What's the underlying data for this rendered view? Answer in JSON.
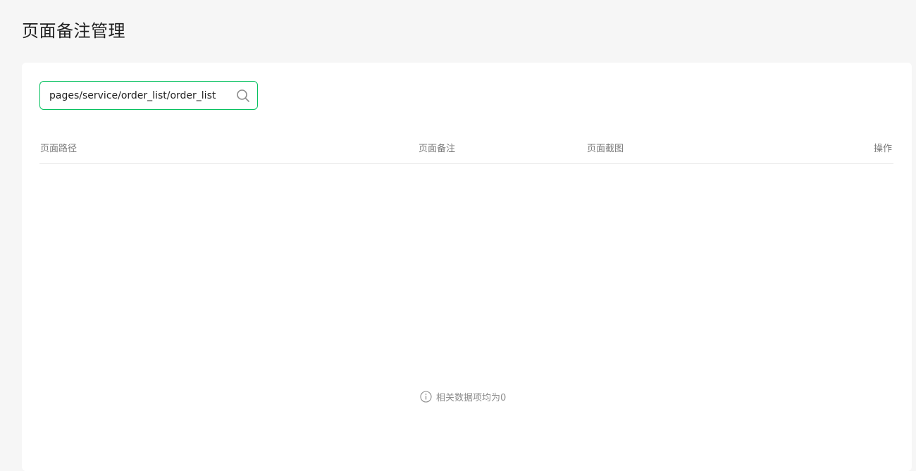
{
  "page": {
    "title": "页面备注管理"
  },
  "search": {
    "value": "pages/service/order_list/order_list",
    "icon": "search-icon"
  },
  "table": {
    "columns": [
      "页面路径",
      "页面备注",
      "页面截图",
      "操作"
    ],
    "rows": []
  },
  "empty": {
    "icon": "info-icon",
    "message": "相关数据项均为0"
  },
  "colors": {
    "accent": "#07c160",
    "background": "#f6f6f6",
    "card": "#ffffff"
  }
}
